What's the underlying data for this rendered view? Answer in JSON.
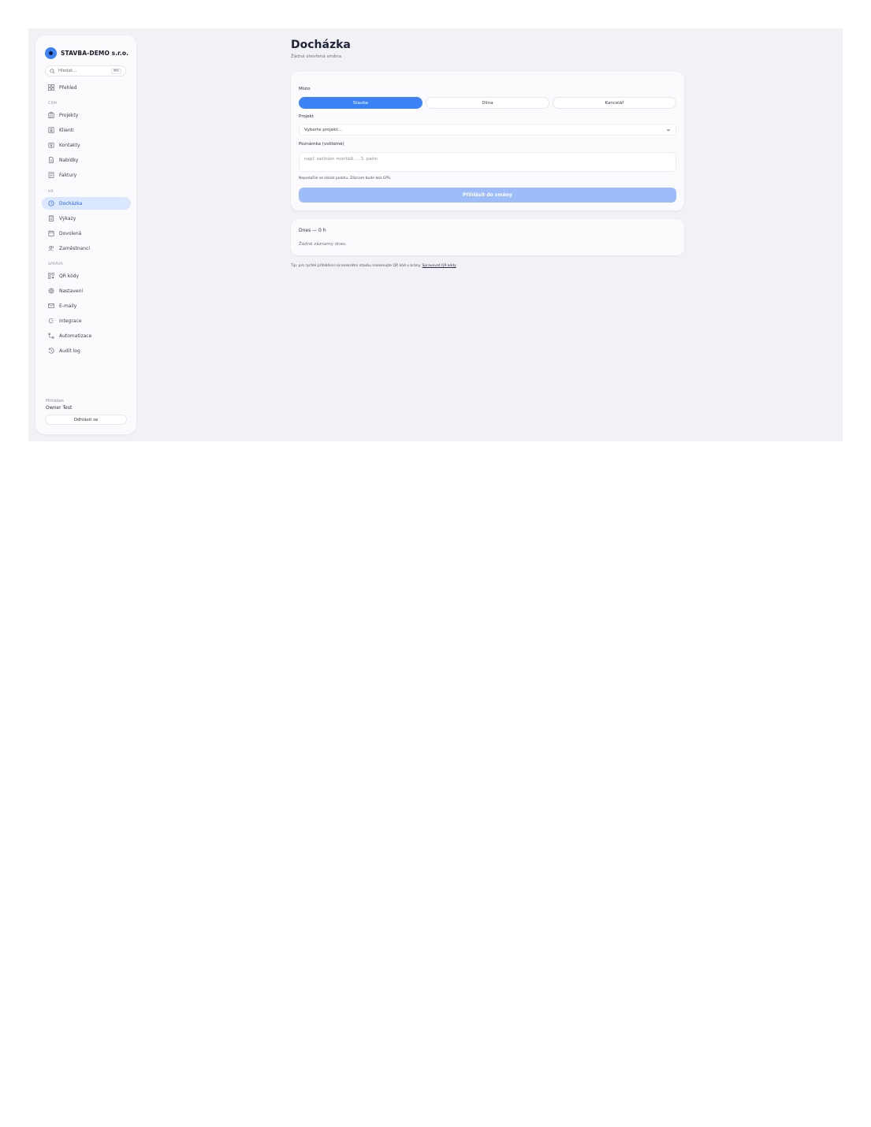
{
  "brand": {
    "name": "STAVBA-DEMO s.r.o."
  },
  "search": {
    "placeholder": "Hledat…",
    "shortcut": "⌘K"
  },
  "sidebar": {
    "top_item": {
      "label": "Přehled",
      "icon": "grid-icon"
    },
    "sections": [
      {
        "label": "CRM",
        "items": [
          {
            "label": "Projekty",
            "icon": "building-icon"
          },
          {
            "label": "Klienti",
            "icon": "contacts-icon"
          },
          {
            "label": "Kontakty",
            "icon": "user-card-icon"
          },
          {
            "label": "Nabídky",
            "icon": "document-icon"
          },
          {
            "label": "Faktury",
            "icon": "invoice-icon"
          }
        ]
      },
      {
        "label": "HR",
        "items": [
          {
            "label": "Docházka",
            "icon": "clock-icon",
            "active": true
          },
          {
            "label": "Výkazy",
            "icon": "clipboard-icon"
          },
          {
            "label": "Dovolená",
            "icon": "calendar-icon"
          },
          {
            "label": "Zaměstnanci",
            "icon": "users-icon"
          }
        ]
      },
      {
        "label": "SPRÁVA",
        "items": [
          {
            "label": "QR kódy",
            "icon": "qr-icon"
          },
          {
            "label": "Nastavení",
            "icon": "gear-icon"
          },
          {
            "label": "E-maily",
            "icon": "mail-icon"
          },
          {
            "label": "Integrace",
            "icon": "plug-icon"
          },
          {
            "label": "Automatizace",
            "icon": "flow-icon"
          },
          {
            "label": "Audit log",
            "icon": "history-icon"
          }
        ]
      }
    ],
    "user": {
      "role": "Přihlášen",
      "name": "Owner Test"
    },
    "logout_label": "Odhlásit se"
  },
  "page": {
    "title": "Docházka",
    "subtitle": "Žádná otevřená směna"
  },
  "form": {
    "place_label": "Místo",
    "place_options": [
      "Stavba",
      "Dílna",
      "Kancelář"
    ],
    "place_selected": "Stavba",
    "project_label": "Projekt",
    "project_value": "Vyberte projekt…",
    "note_label": "Poznámka (volitelné)",
    "note_placeholder": "např. začínám montáží, …3. patro",
    "hint": "Nepodařilo se získat polohu. Záznam bude bez GPS.",
    "submit_label": "Přihlásit do směny"
  },
  "today": {
    "title": "Dnes — 0 h",
    "empty": "Žádné záznamy dnes."
  },
  "tip": {
    "text": "Tip: pro rychlé přihlášení na konkrétní stavbu naskenujte QR kód u brány.",
    "link": "Spravovat QR kódy"
  },
  "colors": {
    "accent": "#3b82f6",
    "active_bg": "#dbe7fd",
    "submit_disabled": "#9dbdfa",
    "canvas": "#f2f2f6"
  }
}
